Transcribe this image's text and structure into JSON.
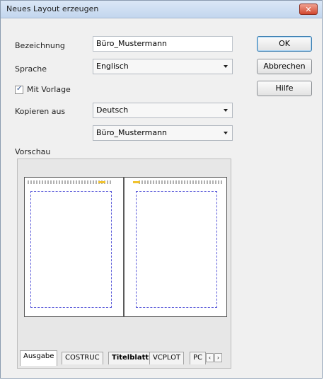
{
  "window": {
    "title": "Neues Layout erzeugen",
    "close_label": "✕"
  },
  "form": {
    "bezeichnung_label": "Bezeichnung",
    "bezeichnung_value": "Büro_Mustermann",
    "sprache_label": "Sprache",
    "sprache_value": "Englisch",
    "vorlage_label": "Mit Vorlage",
    "vorlage_checked": true,
    "kopieren_label": "Kopieren aus",
    "kopieren_value": "Deutsch",
    "kopieren_value2": "Büro_Mustermann",
    "vorschau_label": "Vorschau"
  },
  "buttons": {
    "ok": "OK",
    "cancel": "Abbrechen",
    "help": "Hilfe"
  },
  "tabs": [
    "Ausgabe",
    "COSTRUC",
    "Titelblatt",
    "VCPLOT",
    "PC"
  ],
  "icons": {
    "checkbox_mark": "✓",
    "scroll_left": "‹",
    "scroll_right": "›"
  }
}
